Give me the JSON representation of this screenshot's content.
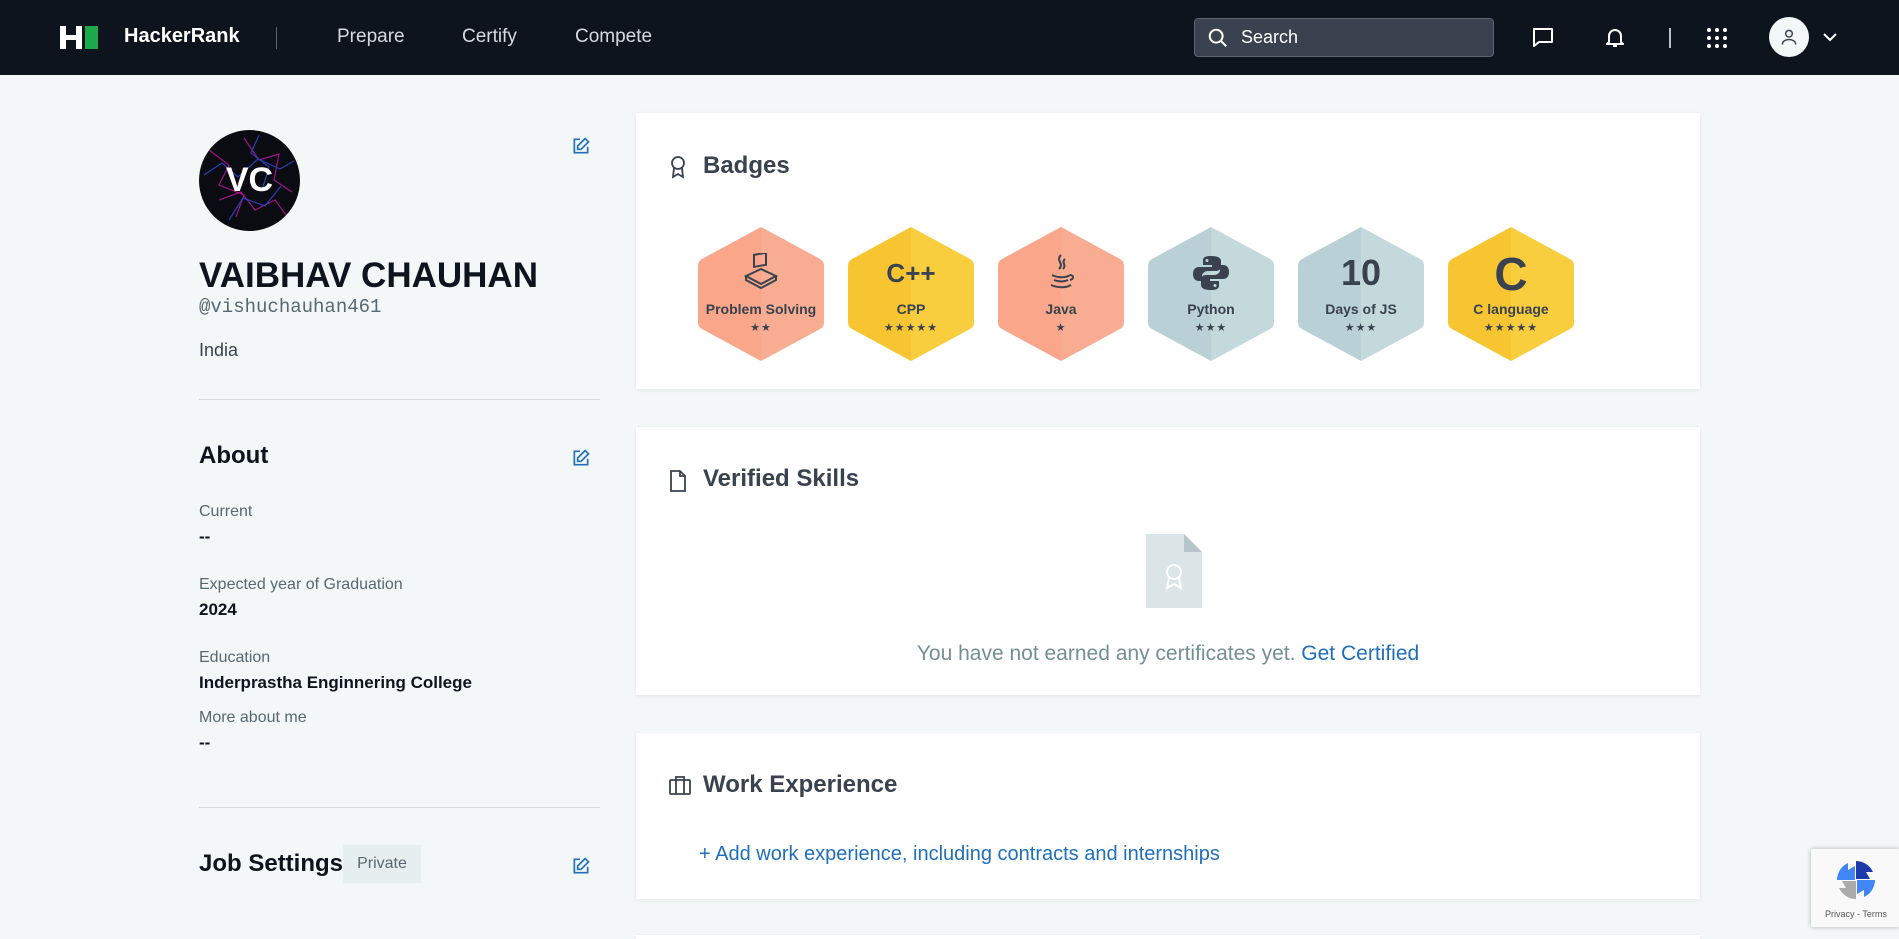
{
  "nav": {
    "brand": "HackerRank",
    "links": [
      "Prepare",
      "Certify",
      "Compete"
    ],
    "search_placeholder": "Search"
  },
  "profile": {
    "initials": "VC",
    "name": "VAIBHAV CHAUHAN",
    "handle": "@vishuchauhan461",
    "country": "India"
  },
  "about": {
    "title": "About",
    "fields": [
      {
        "label": "Current",
        "value": "--"
      },
      {
        "label": "Expected year of Graduation",
        "value": "2024"
      },
      {
        "label": "Education",
        "value": "Inderprastha Enginnering College"
      },
      {
        "label": "More about me",
        "value": "--"
      }
    ]
  },
  "job_settings": {
    "title": "Job Settings",
    "visibility": "Private"
  },
  "badges": {
    "title": "Badges",
    "items": [
      {
        "label": "Problem Solving",
        "stars": "★★",
        "star_count": 2,
        "color": "#f9a68b",
        "icon": "problem-solving-icon"
      },
      {
        "label": "CPP",
        "stars": "★★★★★",
        "star_count": 5,
        "color": "#f7c531",
        "icon": "cpp-icon",
        "glyph": "C++"
      },
      {
        "label": "Java",
        "stars": "★",
        "star_count": 1,
        "color": "#f9a68b",
        "icon": "java-icon"
      },
      {
        "label": "Python",
        "stars": "★★★",
        "star_count": 3,
        "color": "#b9d1d6",
        "icon": "python-icon"
      },
      {
        "label": "Days of JS",
        "stars": "★★★",
        "star_count": 3,
        "color": "#b9d1d6",
        "icon": "days-of-js-icon",
        "glyph": "10"
      },
      {
        "label": "C language",
        "stars": "★★★★★",
        "star_count": 5,
        "color": "#f7c531",
        "icon": "c-language-icon",
        "glyph": "C"
      }
    ]
  },
  "verified_skills": {
    "title": "Verified Skills",
    "empty_text": "You have not earned any certificates yet.",
    "cta": "Get Certified"
  },
  "work_experience": {
    "title": "Work Experience",
    "add_link": "+ Add work experience, including contracts and internships"
  },
  "recaptcha": {
    "text": "Privacy - Terms"
  }
}
